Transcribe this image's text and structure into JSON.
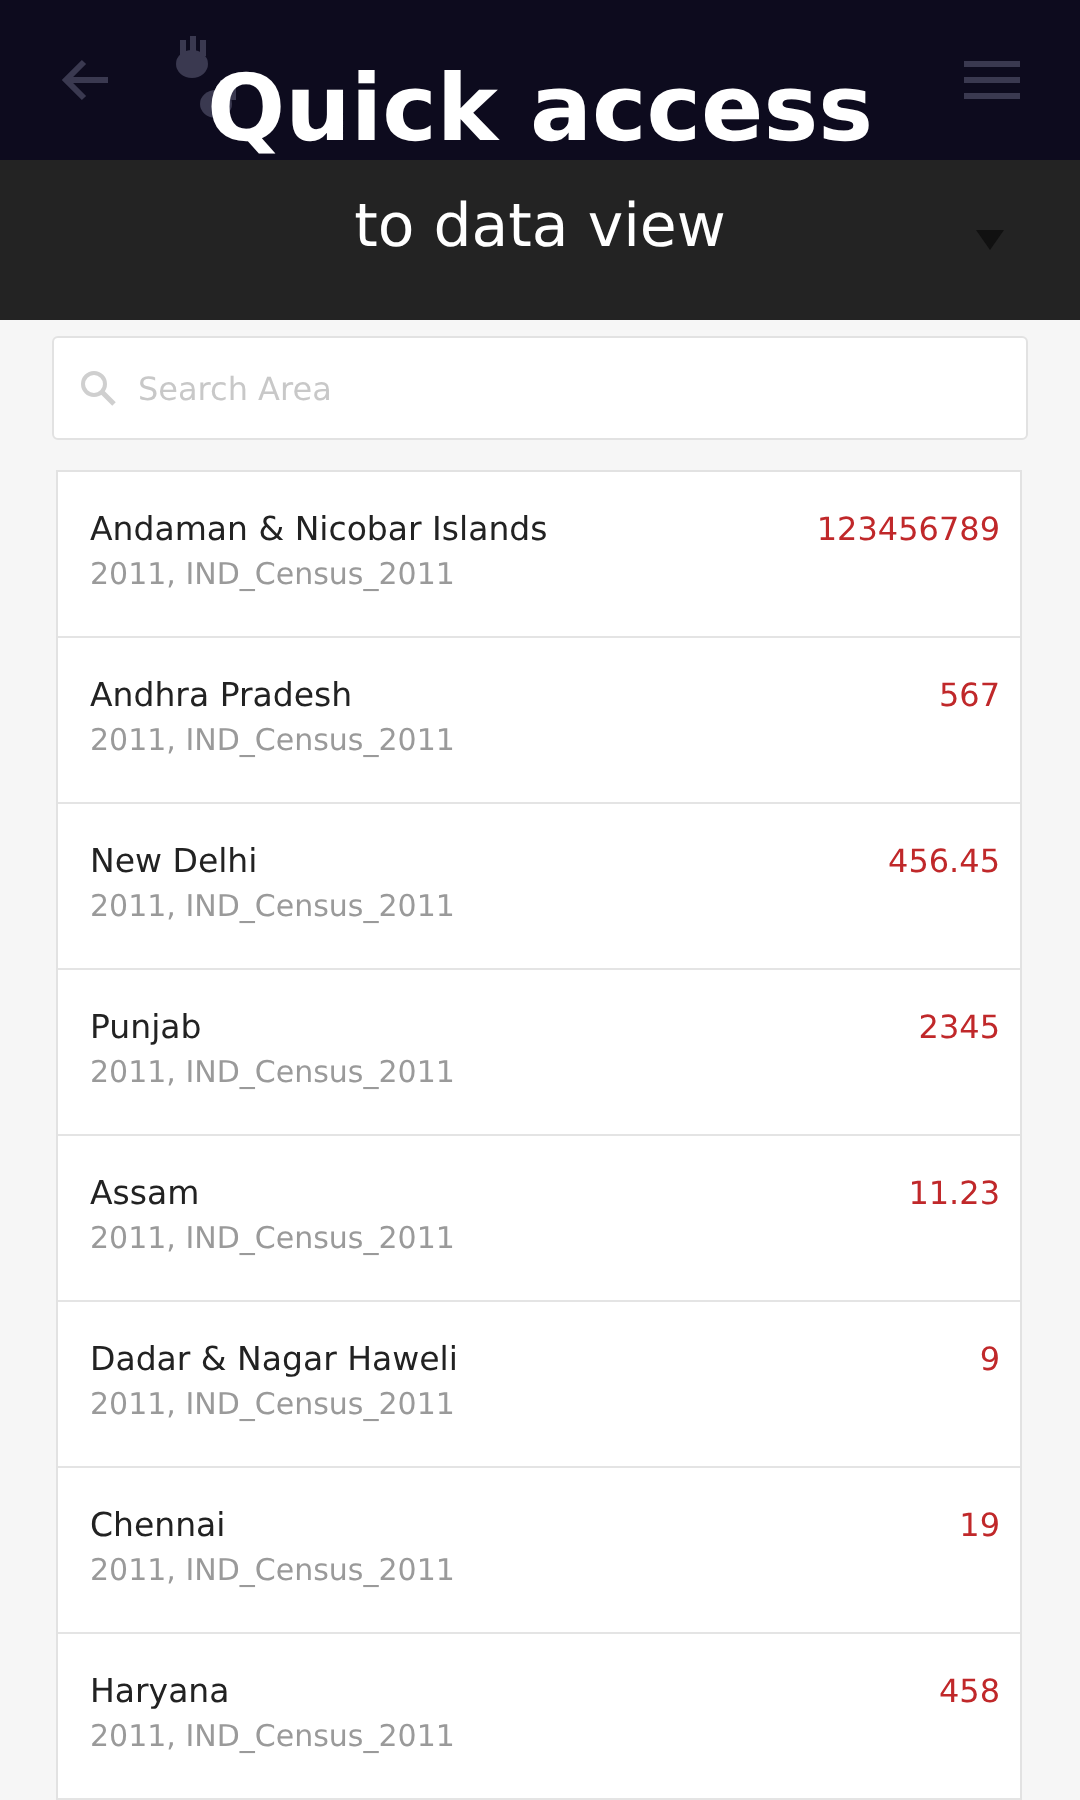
{
  "promo": {
    "headline": "Quick access",
    "subline": "to data view"
  },
  "search": {
    "placeholder": "Search Area"
  },
  "rows": [
    {
      "name": "Andaman & Nicobar Islands",
      "source": "2011, IND_Census_2011",
      "value": "123456789"
    },
    {
      "name": "Andhra Pradesh",
      "source": "2011, IND_Census_2011",
      "value": "567"
    },
    {
      "name": "New Delhi",
      "source": "2011, IND_Census_2011",
      "value": "456.45"
    },
    {
      "name": "Punjab",
      "source": "2011, IND_Census_2011",
      "value": "2345"
    },
    {
      "name": "Assam",
      "source": "2011, IND_Census_2011",
      "value": "11.23"
    },
    {
      "name": "Dadar & Nagar Haweli",
      "source": "2011, IND_Census_2011",
      "value": "9"
    },
    {
      "name": "Chennai",
      "source": "2011, IND_Census_2011",
      "value": "19"
    },
    {
      "name": "Haryana",
      "source": "2011, IND_Census_2011",
      "value": "458"
    }
  ]
}
